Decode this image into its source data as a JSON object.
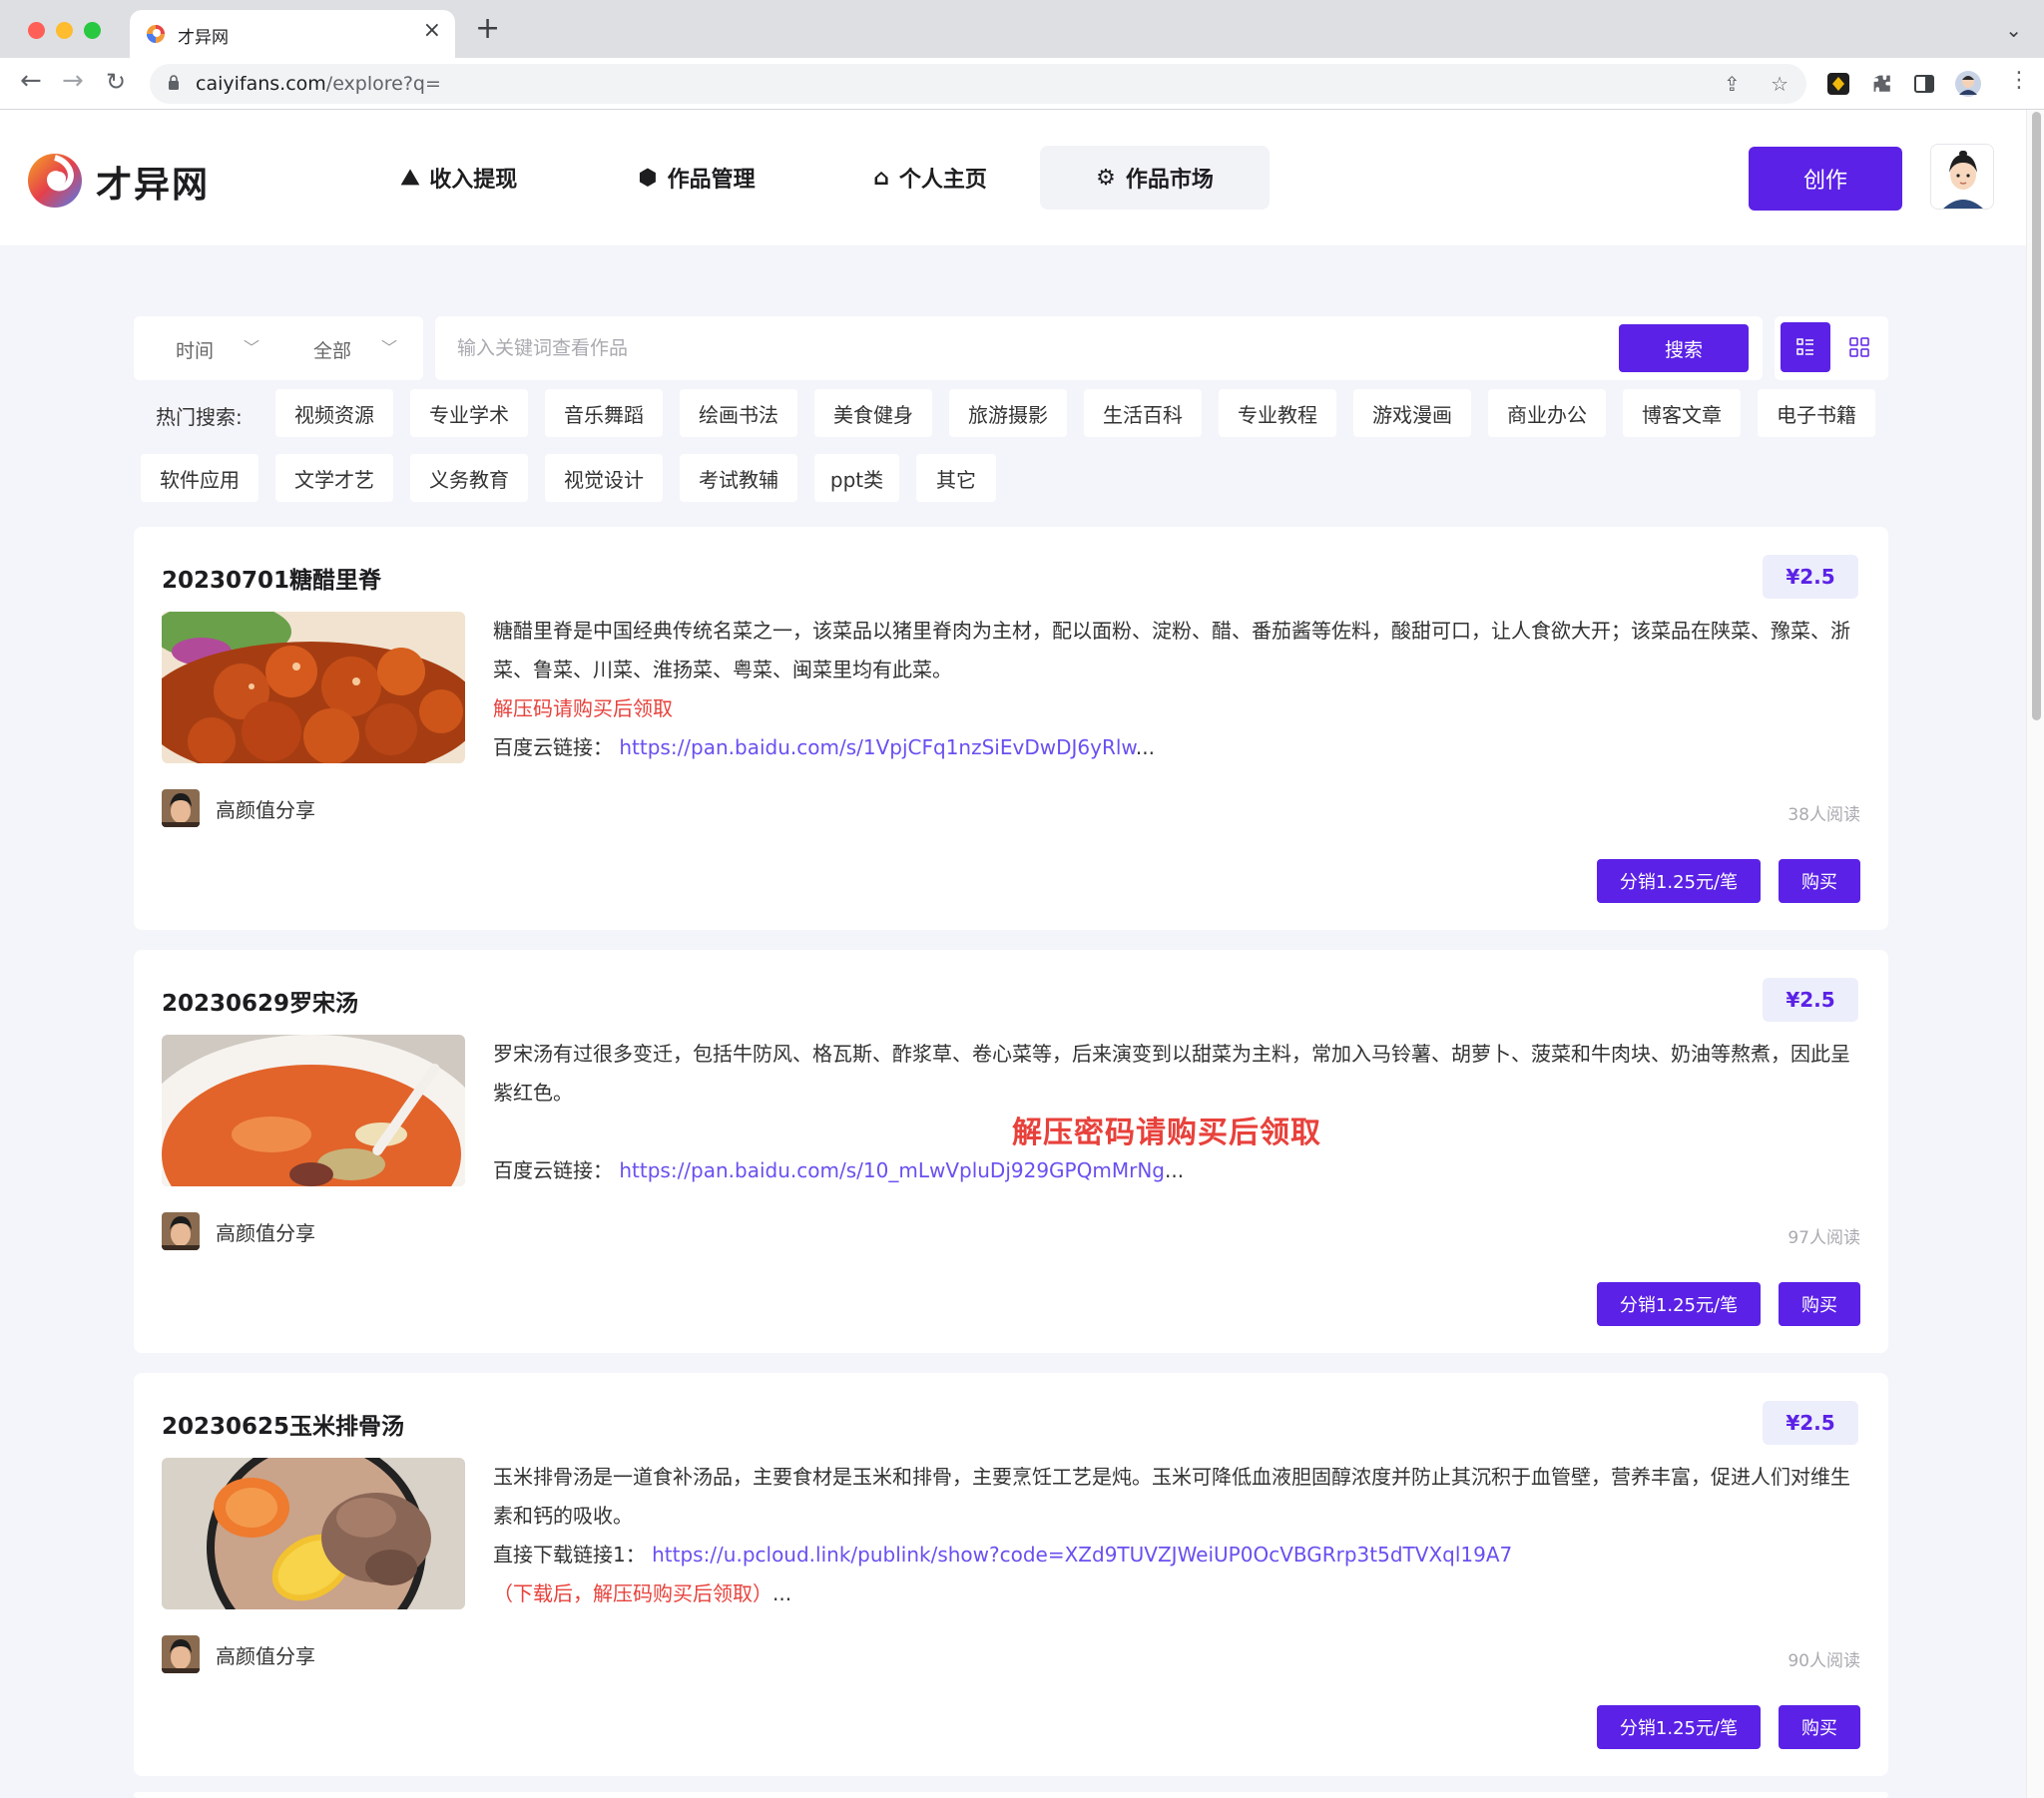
{
  "browser": {
    "tab_title": "才异网",
    "url_host": "caiyifans.com",
    "url_path": "/explore?q="
  },
  "site": {
    "brand": "才异网",
    "nav": [
      {
        "label": "收入提现",
        "icon": "income-chart-icon"
      },
      {
        "label": "作品管理",
        "icon": "box-icon"
      },
      {
        "label": "个人主页",
        "icon": "home-icon"
      },
      {
        "label": "作品市场",
        "icon": "gear-icon",
        "active": true
      }
    ],
    "create_label": "创作"
  },
  "filters": {
    "time_label": "时间",
    "scope_label": "全部",
    "search_placeholder": "输入关键词查看作品",
    "search_button": "搜索"
  },
  "hot": {
    "label": "热门搜索:",
    "tags": [
      "视频资源",
      "专业学术",
      "音乐舞蹈",
      "绘画书法",
      "美食健身",
      "旅游摄影",
      "生活百科",
      "专业教程",
      "游戏漫画",
      "商业办公",
      "博客文章",
      "电子书籍",
      "软件应用",
      "文学才艺",
      "义务教育",
      "视觉设计",
      "考试教辅",
      "ppt类",
      "其它"
    ]
  },
  "cards": [
    {
      "title": "20230701糖醋里脊",
      "price": "¥2.5",
      "desc": "糖醋里脊是中国经典传统名菜之一，该菜品以猪里脊肉为主材，配以面粉、淀粉、醋、番茄酱等佐料，酸甜可口，让人食欲大开；该菜品在陕菜、豫菜、浙菜、鲁菜、川菜、淮扬菜、粤菜、闽菜里均有此菜。",
      "note": "解压码请购买后领取",
      "link_label": "百度云链接：",
      "link": "https://pan.baidu.com/s/1VpjCFq1nzSiEvDwDJ6yRlw",
      "ellipsis": "...",
      "author": "高颜值分享",
      "reads": "38人阅读",
      "dist_label": "分销1.25元/笔",
      "buy_label": "购买"
    },
    {
      "title": "20230629罗宋汤",
      "price": "¥2.5",
      "desc": "罗宋汤有过很多变迁，包括牛防风、格瓦斯、酢浆草、卷心菜等，后来演变到以甜菜为主料，常加入马铃薯、胡萝卜、菠菜和牛肉块、奶油等熬煮，因此呈紫红色。",
      "note": "解压密码请购买后领取",
      "link_label": "百度云链接：",
      "link": "https://pan.baidu.com/s/10_mLwVpluDj929GPQmMrNg",
      "ellipsis": "...",
      "author": "高颜值分享",
      "reads": "97人阅读",
      "dist_label": "分销1.25元/笔",
      "buy_label": "购买"
    },
    {
      "title": "20230625玉米排骨汤",
      "price": "¥2.5",
      "desc": "玉米排骨汤是一道食补汤品，主要食材是玉米和排骨，主要烹饪工艺是炖。玉米可降低血液胆固醇浓度并防止其沉积于血管壁，营养丰富，促进人们对维生素和钙的吸收。",
      "link_label": "直接下载链接1：",
      "link": "https://u.pcloud.link/publink/show?code=XZd9TUVZJWeiUP0OcVBGRrp3t5dTVXql19A7",
      "note": "（下载后，解压码购买后领取）",
      "ellipsis": "...",
      "author": "高颜值分享",
      "reads": "90人阅读",
      "dist_label": "分销1.25元/笔",
      "buy_label": "购买"
    }
  ]
}
